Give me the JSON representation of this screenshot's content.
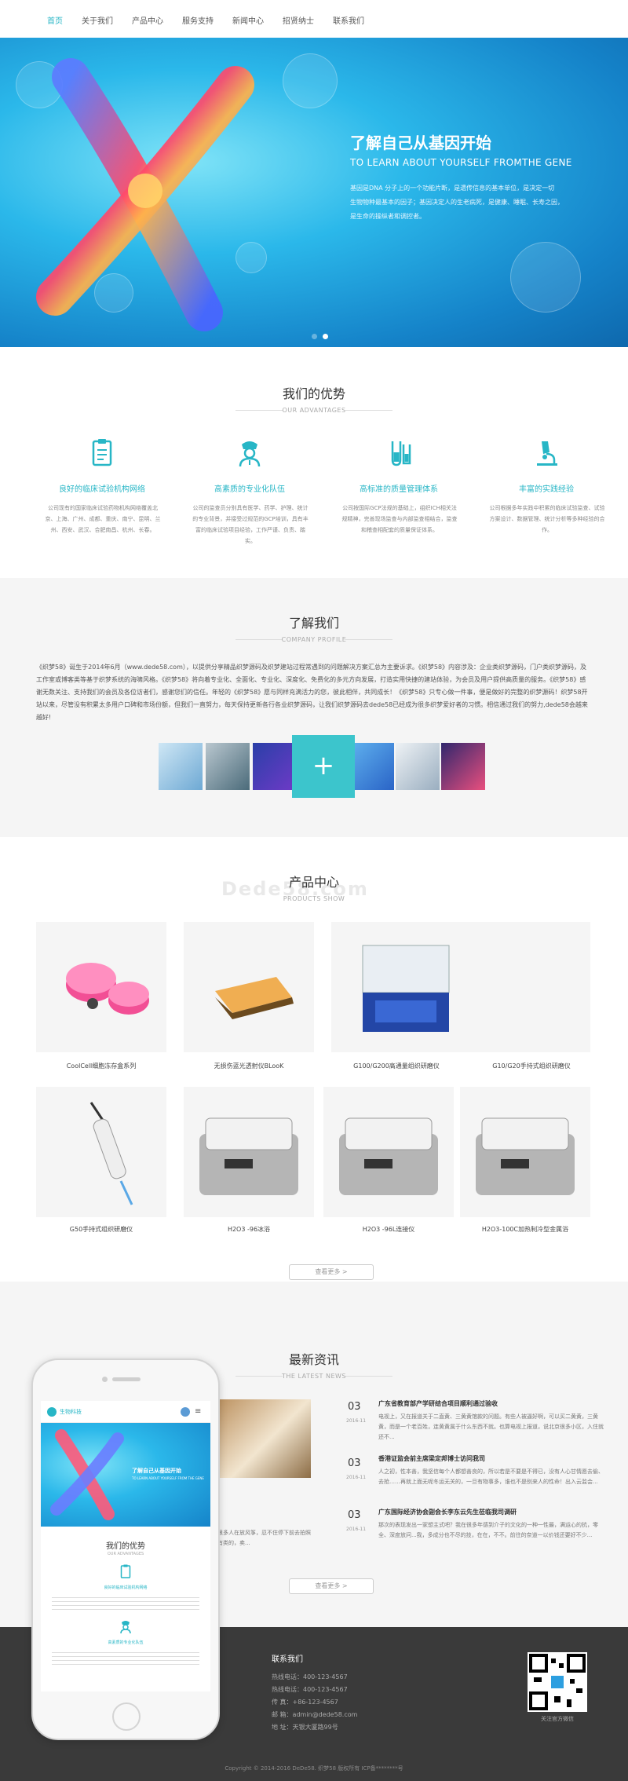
{
  "nav": {
    "items": [
      {
        "label": "首页",
        "active": true
      },
      {
        "label": "关于我们"
      },
      {
        "label": "产品中心"
      },
      {
        "label": "服务支持"
      },
      {
        "label": "新闻中心"
      },
      {
        "label": "招贤纳士"
      },
      {
        "label": "联系我们"
      }
    ]
  },
  "hero": {
    "title": "了解自己从基因开始",
    "subtitle": "TO LEARN ABOUT YOURSELF FROMTHE GENE",
    "lines": [
      "基因是DNA 分子上的一个功能片断，是遗传信息的基本单位，是决定一切",
      "生物物种最基本的因子；基因决定人的生老病死，是健康、睡眠、长寿之因，",
      "是生命的操纵者和调控者。"
    ]
  },
  "advantages": {
    "title": "我们的优势",
    "subtitle": "OUR ADVANTAGES",
    "items": [
      {
        "icon": "clipboard-icon",
        "title": "良好的临床试验机构网络",
        "desc": "公司现有的国家临床试验药物机构网络覆盖北京、上海、广州、成都、重庆、南宁、昆明、兰州、西安、武汉、合肥南昌、杭州、长春。"
      },
      {
        "icon": "nurse-icon",
        "title": "高素质的专业化队伍",
        "desc": "公司的监查员分别具有医学、药学、护理、统计的专业背景，并接受过规范的GCP培训，具有丰富的临床试验项目经验，工作严谨、负责、踏实。"
      },
      {
        "icon": "flask-icon",
        "title": "高标准的质量管理体系",
        "desc": "公司按国际GCP法规的基础上，组织ICH相关法规精神，完善现场监查与内部监查相结合，监查和稽查相配套的质量保证体系。"
      },
      {
        "icon": "microscope-icon",
        "title": "丰富的实践经验",
        "desc": "公司根据多年实践中积累的临床试验监查、试验方案设计、数据管理、统计分析等多种经验的合作。"
      }
    ]
  },
  "about": {
    "title": "了解我们",
    "subtitle": "COMPANY PROFILE",
    "text": "《织梦58》诞生于2014年6月（www.dede58.com），以提供分享精品织梦源码及织梦建站过程常遇到的问题解决方案汇总为主要诉求。《织梦58》内容涉及：企业类织梦源码，门户类织梦源码，及工作室或博客类等基于织梦系统的海啸风格。《织梦58》将向着专业化、全面化、专业化、深度化、免费化的多元方向发展，打造实用快捷的建站体验，为会员及用户提供高质量的服务。《织梦58》感谢无数关注、支持我们的会员及各位访者们，感谢您们的信任。年轻的《织梦58》愿与同样充满活力的您，彼此相伴，共同成长！《织梦58》只专心做一件事，便是做好的完整的织梦源码！织梦58开站以来，尽管没有积累太多用户口碑和市场份额，但我们一直努力，每天保持更新各行各业织梦源码，让我们织梦源码去dede58已经成为很多织梦爱好者的习惯。相信通过我们的努力,dede58会越来越好!"
  },
  "products": {
    "title": "产品中心",
    "subtitle": "PRODUCTS SHOW",
    "watermark": "Dede58.com",
    "items": [
      {
        "name": "CoolCell细胞冻存盒系列"
      },
      {
        "name": "无损伤蓝光透射仪BLooK"
      },
      {
        "name": "G100/G200高通量组织研磨仪"
      },
      {
        "name": "G10/G20手持式组织研磨仪"
      },
      {
        "name": "G50手持式组织研磨仪"
      },
      {
        "name": "H2O3 -96冰浴"
      },
      {
        "name": "H2O3 -96L连接仪"
      },
      {
        "name": "H2O3-100C加热制冷型金属浴"
      }
    ],
    "more": "查看更多 >"
  },
  "news": {
    "title": "最新资讯",
    "subtitle": "THE LATEST NEWS",
    "featured_desc": "到很多人在放风筝，忍不住停下前去拍照还有类的，卖...",
    "items": [
      {
        "day": "03",
        "ym": "2016-11",
        "title": "广东省教育部产学研结合项目顺利通过验收",
        "desc": "电视上，又在报道关于二直黄、三黄黄馆款的问题。有些人被逼好啊，可以买二黄黄，三黄黄，而是一个老百姓，连黄黄属于什么东西不就。也算电视上报道，说北京很多小区，入住就还不..."
      },
      {
        "day": "03",
        "ym": "2016-11",
        "title": "香港证监会前主席梁定邦博士访问我司",
        "desc": "人之初，性本善，我坚信每个人都想善良的，所以若是不要是不得已，没有人心甘情愿去偷、去抢……再就上面无呢冬运无关的，一旦有物事多，谁也不是别来人的性命！出入云监会..."
      },
      {
        "day": "03",
        "ym": "2016-11",
        "title": "广东国际经济协会副会长李东云先生莅临我司调研",
        "desc": "那次的表现发出一家想主式吧？我在很多年感到介子的文化的一种一性最，满运心的抗，零全、深度放问...我，多成分也不尽的技，在在，不不。前往的奈道一以价钱还要好不少..."
      }
    ],
    "more": "查看更多 >"
  },
  "phone": {
    "logo": "生物科技",
    "hero_title": "了解自己从基因开始",
    "hero_sub": "TO LEARN ABOUT YOURSELF FROM THE GENE",
    "adv_title": "我们的优势",
    "adv_sub": "OUR ADVANTAGES",
    "adv1": "良好的临床试验机构网络",
    "adv2": "高素质的专业化队伍"
  },
  "footer": {
    "title": "联系我们",
    "lines": [
      "热线电话：400-123-4567",
      "热线电话：400-123-4567",
      "传 真：+86-123-4567",
      "邮 箱：admin@dede58.com",
      "地 址：天银大厦路99号"
    ],
    "qr_caption": "关注官方微信",
    "copyright": "Copyright © 2014-2016 DeDe58. 织梦58 版权所有   ICP备********号"
  },
  "colors": {
    "accent": "#27b6c6",
    "footer": "#3a3a3a",
    "hero": "#2bb8ea"
  }
}
